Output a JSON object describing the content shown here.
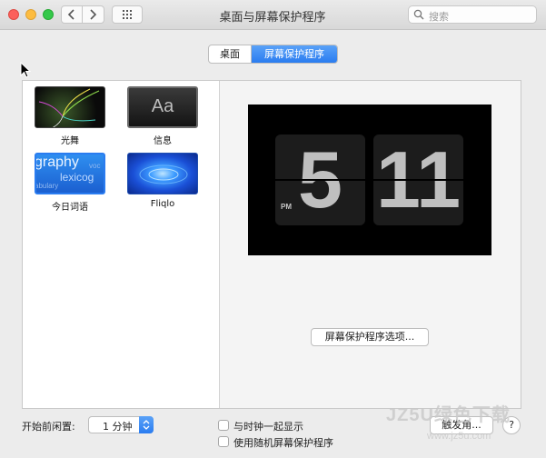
{
  "window": {
    "title": "桌面与屏幕保护程序",
    "search_placeholder": "搜索"
  },
  "tabs": [
    {
      "label": "桌面",
      "selected": false
    },
    {
      "label": "屏幕保护程序",
      "selected": true
    }
  ],
  "screensavers": [
    {
      "label": "光舞",
      "thumb_text": ""
    },
    {
      "label": "信息",
      "thumb_text": "Aa"
    },
    {
      "label": "今日词语",
      "thumb_text": "graphy"
    },
    {
      "label": "Fliqlo",
      "thumb_text": ""
    }
  ],
  "word_thumb_extra": [
    "lexicog",
    "voc",
    "abulary"
  ],
  "preview": {
    "hour": "5",
    "minute": "11",
    "meridiem": "PM"
  },
  "options_button": "屏幕保护程序选项...",
  "start_after": {
    "label": "开始前闲置:",
    "value": "1 分钟"
  },
  "checkboxes": {
    "show_clock": "与时钟一起显示",
    "random": "使用随机屏幕保护程序"
  },
  "hot_corners_button": "触发角...",
  "help_button": "?",
  "watermark": {
    "main": "JZ5U绿色下载",
    "sub": "www.jz5u.com"
  },
  "colors": {
    "accent": "#2a7cf0",
    "close": "#fc605b",
    "minimize": "#fdbc40",
    "zoom": "#34c84a"
  }
}
